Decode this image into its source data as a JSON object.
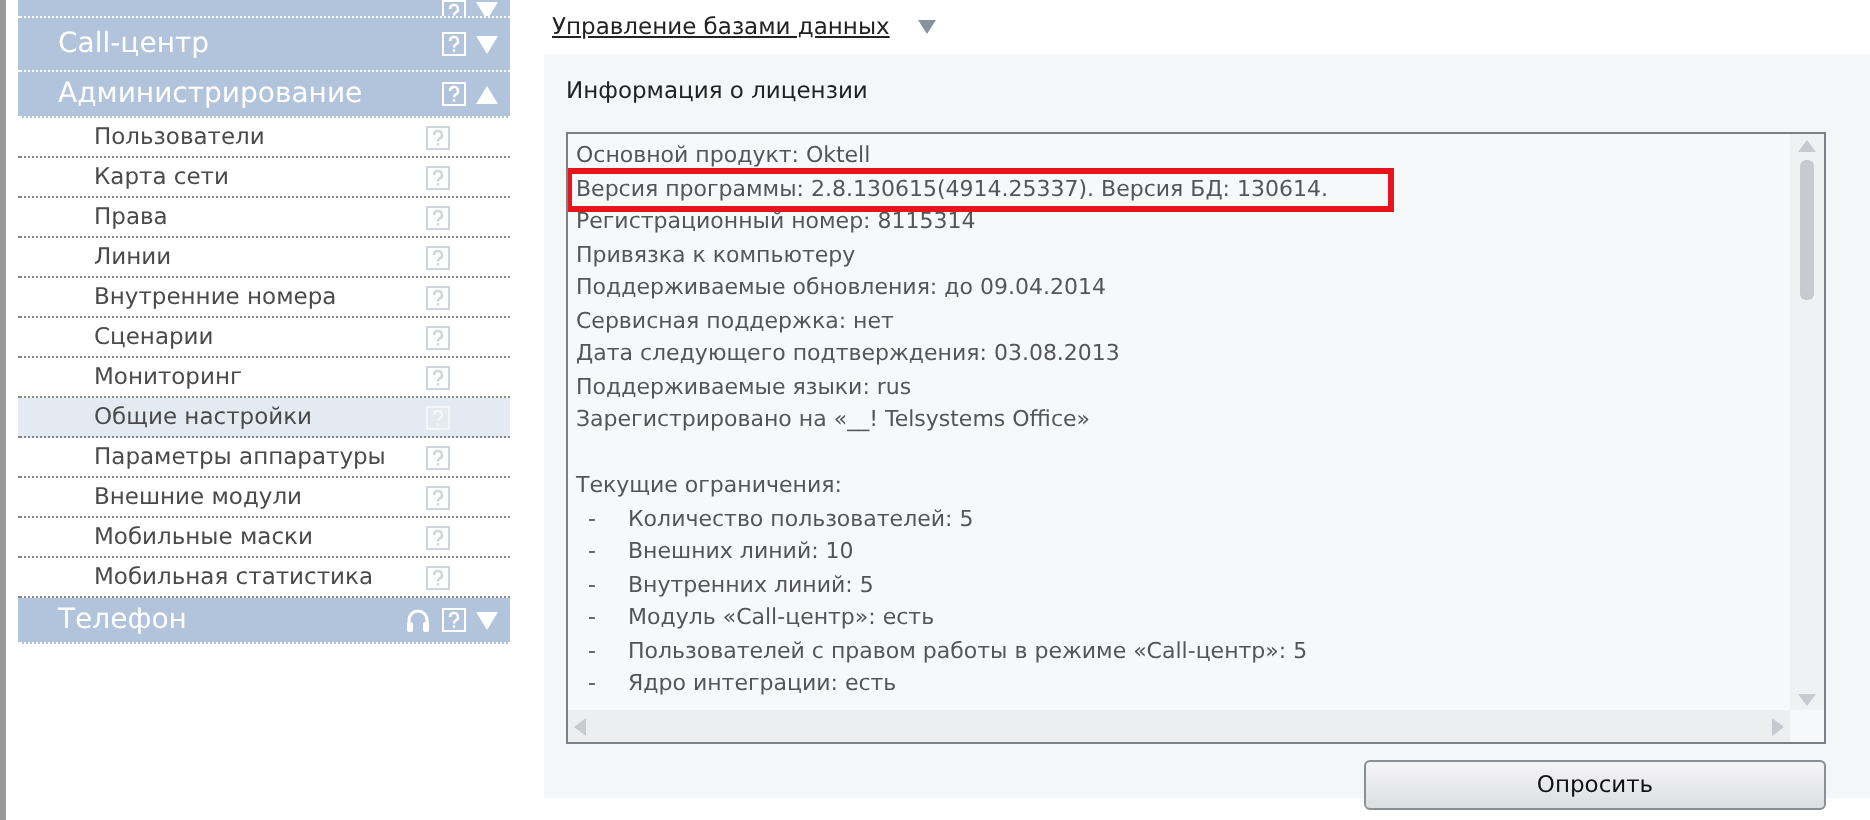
{
  "sidebar": {
    "sections": [
      {
        "expanded": false
      },
      {
        "label": "Call-центр",
        "expanded": false
      },
      {
        "label": "Администрирование",
        "expanded": true,
        "items": [
          {
            "label": "Пользователи",
            "selected": false
          },
          {
            "label": "Карта сети",
            "selected": false
          },
          {
            "label": "Права",
            "selected": false
          },
          {
            "label": "Линии",
            "selected": false
          },
          {
            "label": "Внутренние номера",
            "selected": false
          },
          {
            "label": "Сценарии",
            "selected": false
          },
          {
            "label": "Мониторинг",
            "selected": false
          },
          {
            "label": "Общие настройки",
            "selected": true
          },
          {
            "label": "Параметры аппаратуры",
            "selected": false
          },
          {
            "label": "Внешние модули",
            "selected": false
          },
          {
            "label": "Мобильные маски",
            "selected": false
          },
          {
            "label": "Мобильная статистика",
            "selected": false
          }
        ]
      },
      {
        "label": "Телефон",
        "expanded": false,
        "headset": true
      }
    ]
  },
  "breadcrumb": {
    "link": "Управление базами данных"
  },
  "panel": {
    "title": "Информация о лицензии",
    "lines": [
      {
        "kind": "text",
        "text": "Основной продукт: Oktell",
        "highlighted": false
      },
      {
        "kind": "text",
        "text": "Версия программы: 2.8.130615(4914.25337). Версия БД: 130614.",
        "highlighted": true
      },
      {
        "kind": "text",
        "text": "Регистрационный номер: 8115314",
        "highlighted": false
      },
      {
        "kind": "text",
        "text": "Привязка к компьютеру",
        "highlighted": false
      },
      {
        "kind": "text",
        "text": "Поддерживаемые обновления: до 09.04.2014",
        "highlighted": false
      },
      {
        "kind": "text",
        "text": "Сервисная поддержка: нет",
        "highlighted": false
      },
      {
        "kind": "text",
        "text": "Дата следующего подтверждения: 03.08.2013",
        "highlighted": false
      },
      {
        "kind": "text",
        "text": "Поддерживаемые языки: rus",
        "highlighted": false
      },
      {
        "kind": "text",
        "text": "Зарегистрировано на «__! Telsystems Office»",
        "highlighted": false
      },
      {
        "kind": "blank"
      },
      {
        "kind": "text",
        "text": "Текущие ограничения:",
        "highlighted": false
      },
      {
        "kind": "bullet",
        "marker": "-",
        "text": "Количество пользователей: 5",
        "highlighted": false
      },
      {
        "kind": "bullet",
        "marker": "-",
        "text": "Внешних линий: 10",
        "highlighted": false
      },
      {
        "kind": "bullet",
        "marker": "-",
        "text": "Внутренних линий: 5",
        "highlighted": false
      },
      {
        "kind": "bullet",
        "marker": "-",
        "text": "Модуль «Call-центр»: есть",
        "highlighted": false
      },
      {
        "kind": "bullet",
        "marker": "-",
        "text": "Пользователей с правом работы в режиме «Call-центр»: 5",
        "highlighted": false
      },
      {
        "kind": "bullet",
        "marker": "-",
        "text": "Ядро интеграции: есть",
        "highlighted": false
      }
    ],
    "button": "Опросить"
  }
}
